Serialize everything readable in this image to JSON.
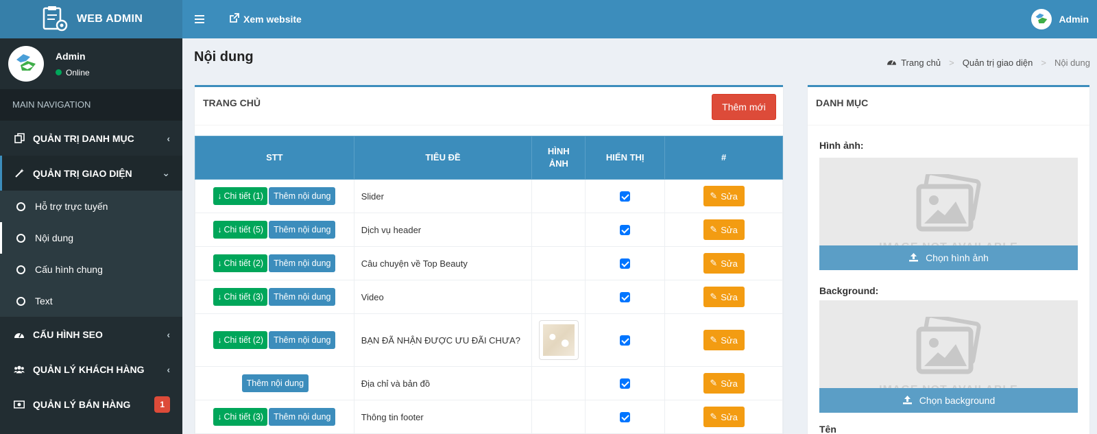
{
  "brand": {
    "title": "WEB ADMIN"
  },
  "user": {
    "name": "Admin",
    "status": "Online"
  },
  "topbar": {
    "view_site": "Xem website",
    "user_name": "Admin"
  },
  "nav": {
    "header": "MAIN NAVIGATION",
    "items": [
      {
        "label": "QUẢN TRỊ DANH MỤC",
        "icon": "copy-icon"
      },
      {
        "label": "QUẢN TRỊ GIAO DIỆN",
        "icon": "magic-wand-icon",
        "expanded": true,
        "children": [
          {
            "label": "Hỗ trợ trực tuyến"
          },
          {
            "label": "Nội dung",
            "active": true
          },
          {
            "label": "Cấu hình chung"
          },
          {
            "label": "Text"
          }
        ]
      },
      {
        "label": "CẤU HÌNH SEO",
        "icon": "dashboard-icon"
      },
      {
        "label": "QUẢN LÝ KHÁCH HÀNG",
        "icon": "users-icon"
      },
      {
        "label": "QUẢN LÝ BÁN HÀNG",
        "icon": "money-icon",
        "badge": "1"
      }
    ]
  },
  "page": {
    "title": "Nội dung"
  },
  "breadcrumb": {
    "home": "Trang chủ",
    "parent": "Quản trị giao diện",
    "current": "Nội dung"
  },
  "main_box": {
    "title": "TRANG CHỦ",
    "add_button": "Thêm mới",
    "columns": {
      "stt": "STT",
      "title": "TIÊU ĐỀ",
      "image_l1": "HÌNH",
      "image_l2": "ẢNH",
      "show": "HIỂN THỊ",
      "action": "#"
    },
    "add_content_label": "Thêm nội dung",
    "edit_label": "Sửa",
    "rows": [
      {
        "detail": "Chi tiết (1)",
        "title": "Slider",
        "checked": true
      },
      {
        "detail": "Chi tiết (5)",
        "title": "Dịch vụ header",
        "checked": true
      },
      {
        "detail": "Chi tiết (2)",
        "title": "Câu chuyện về Top Beauty",
        "checked": true
      },
      {
        "detail": "Chi tiết (3)",
        "title": "Video",
        "checked": true
      },
      {
        "detail": "Chi tiết (2)",
        "title": "BẠN ĐÃ NHẬN ĐƯỢC ƯU ĐÃI CHƯA?",
        "checked": true,
        "has_image": true
      },
      {
        "detail": "",
        "title": "Địa chỉ và bản đồ",
        "checked": true
      },
      {
        "detail": "Chi tiết (3)",
        "title": "Thông tin footer",
        "checked": true
      }
    ]
  },
  "side_box": {
    "title": "DANH MỤC",
    "image_label": "Hình ảnh:",
    "image_button": "Chọn hình ảnh",
    "background_label": "Background:",
    "background_button": "Chọn background",
    "placeholder_text": "IMAGE NOT AVAILABLE",
    "name_label": "Tên"
  },
  "colors": {
    "primary": "#3c8dbc",
    "sidebar": "#222d32",
    "success": "#00a65a",
    "danger": "#dd4b39",
    "warning": "#f39c12"
  }
}
